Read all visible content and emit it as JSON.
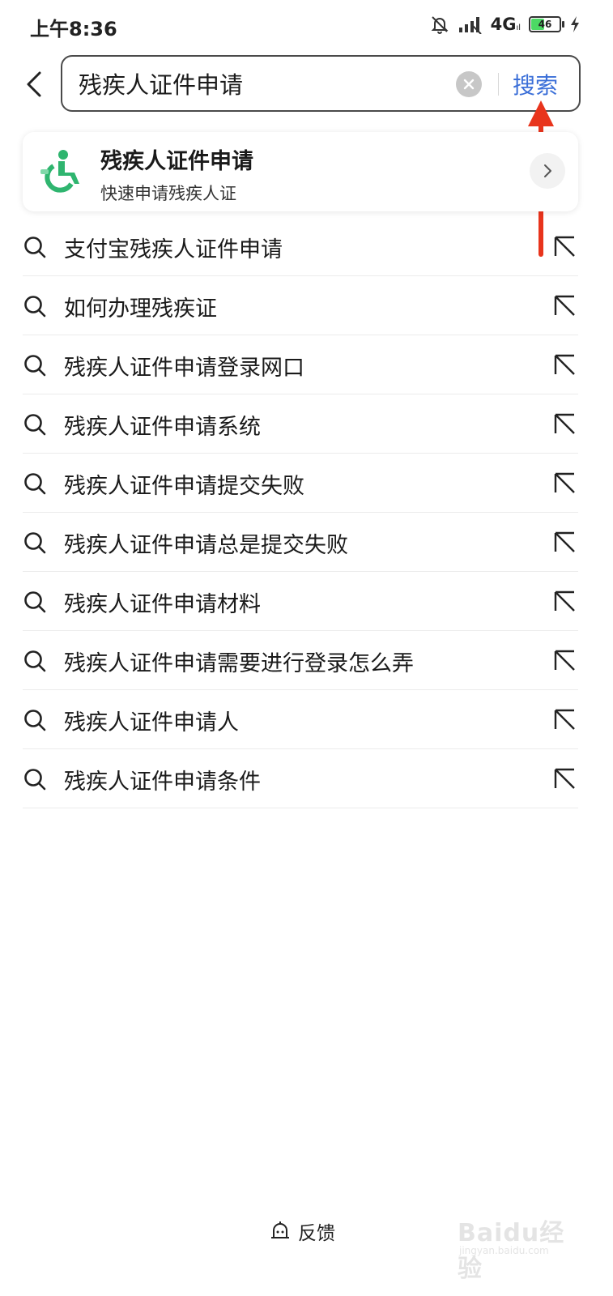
{
  "status_bar": {
    "time": "上午8:36",
    "network": "4G",
    "battery_level": "46",
    "battery_fraction": 0.46,
    "icons": [
      "bell-off-icon",
      "signal-icon",
      "signal-no-sim-icon",
      "battery-icon",
      "charging-icon"
    ]
  },
  "header": {
    "back_icon": "chevron-left-icon",
    "search_value": "残疾人证件申请",
    "clear_icon": "clear-circle-icon",
    "search_button_label": "搜索"
  },
  "service_card": {
    "icon": "wheelchair-icon",
    "title": "残疾人证件申请",
    "subtitle": "快速申请残疾人证",
    "arrow_icon": "chevron-right-icon"
  },
  "suggestions": [
    {
      "text": "支付宝残疾人证件申请"
    },
    {
      "text": "如何办理残疾证"
    },
    {
      "text": "残疾人证件申请登录网口"
    },
    {
      "text": "残疾人证件申请系统"
    },
    {
      "text": "残疾人证件申请提交失败"
    },
    {
      "text": "残疾人证件申请总是提交失败"
    },
    {
      "text": "残疾人证件申请材料"
    },
    {
      "text": "残疾人证件申请需要进行登录怎么弄"
    },
    {
      "text": "残疾人证件申请人"
    },
    {
      "text": "残疾人证件申请条件"
    }
  ],
  "feedback": {
    "icon": "feedback-bell-icon",
    "label": "反馈"
  },
  "watermark": {
    "text": "Baidu经验",
    "sub": "jingyan.baidu.com"
  },
  "colors": {
    "accent": "#3b6fd8",
    "annotation": "#e8341c",
    "service_green": "#2fb56f"
  }
}
